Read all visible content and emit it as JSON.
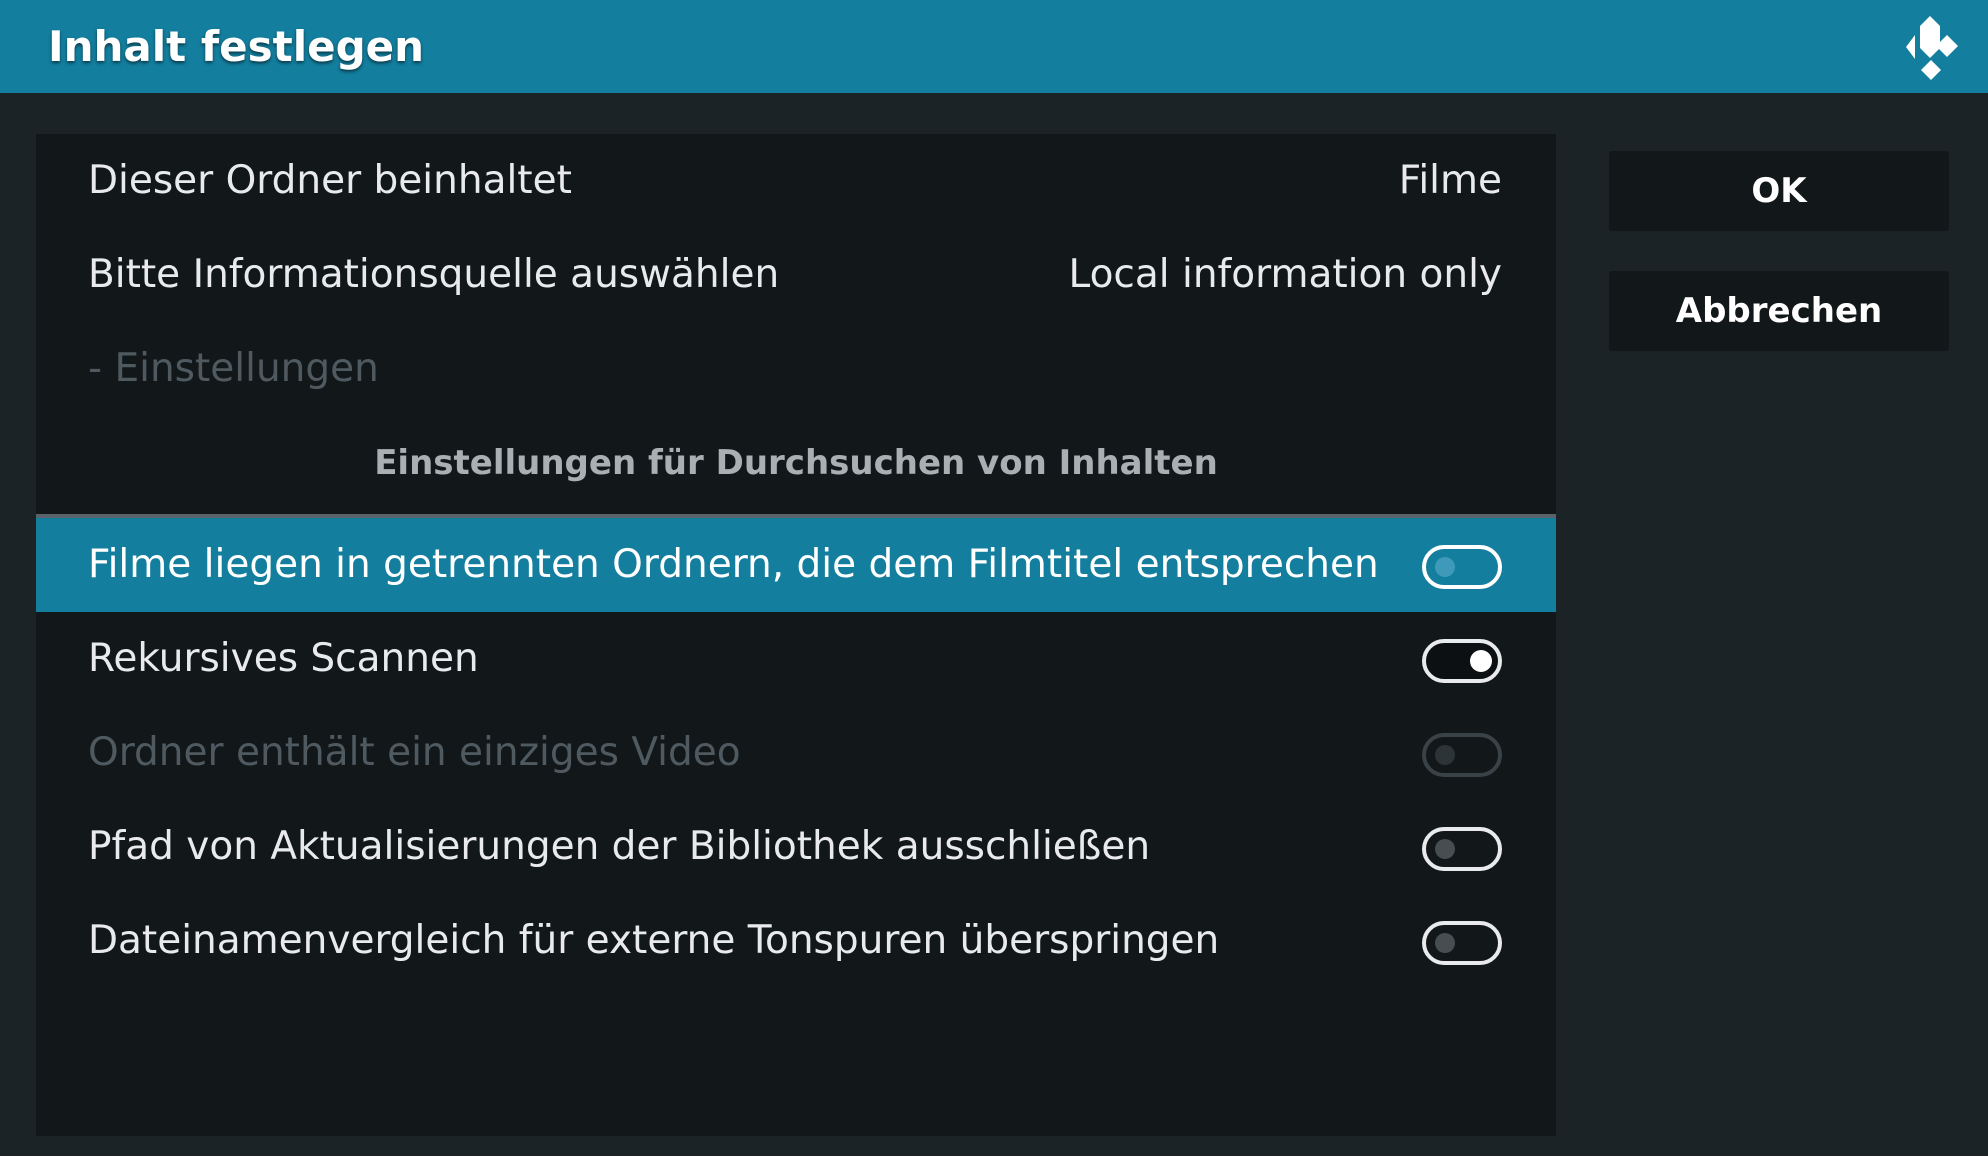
{
  "header": {
    "title": "Inhalt festlegen"
  },
  "icons": {
    "logo": "kodi-logo-icon"
  },
  "colors": {
    "accent": "#137e9e",
    "background": "#1b2327",
    "panel": "#12171a"
  },
  "rows": {
    "content_type": {
      "label": "Dieser Ordner beinhaltet",
      "value": "Filme"
    },
    "scraper": {
      "label": "Bitte Informationsquelle auswählen",
      "value": "Local information only"
    },
    "settings": {
      "label": "- Einstellungen"
    }
  },
  "section": {
    "title": "Einstellungen für Durchsuchen von Inhalten"
  },
  "toggles": [
    {
      "label": "Filme liegen in getrennten Ordnern, die dem Filmtitel entsprechen",
      "state": "off"
    },
    {
      "label": "Rekursives Scannen",
      "state": "on"
    },
    {
      "label": "Ordner enthält ein einziges Video",
      "state": "off"
    },
    {
      "label": "Pfad von Aktualisierungen der Bibliothek ausschließen",
      "state": "off"
    },
    {
      "label": "Dateinamenvergleich für externe Tonspuren überspringen",
      "state": "off"
    }
  ],
  "buttons": {
    "ok": "OK",
    "cancel": "Abbrechen"
  }
}
